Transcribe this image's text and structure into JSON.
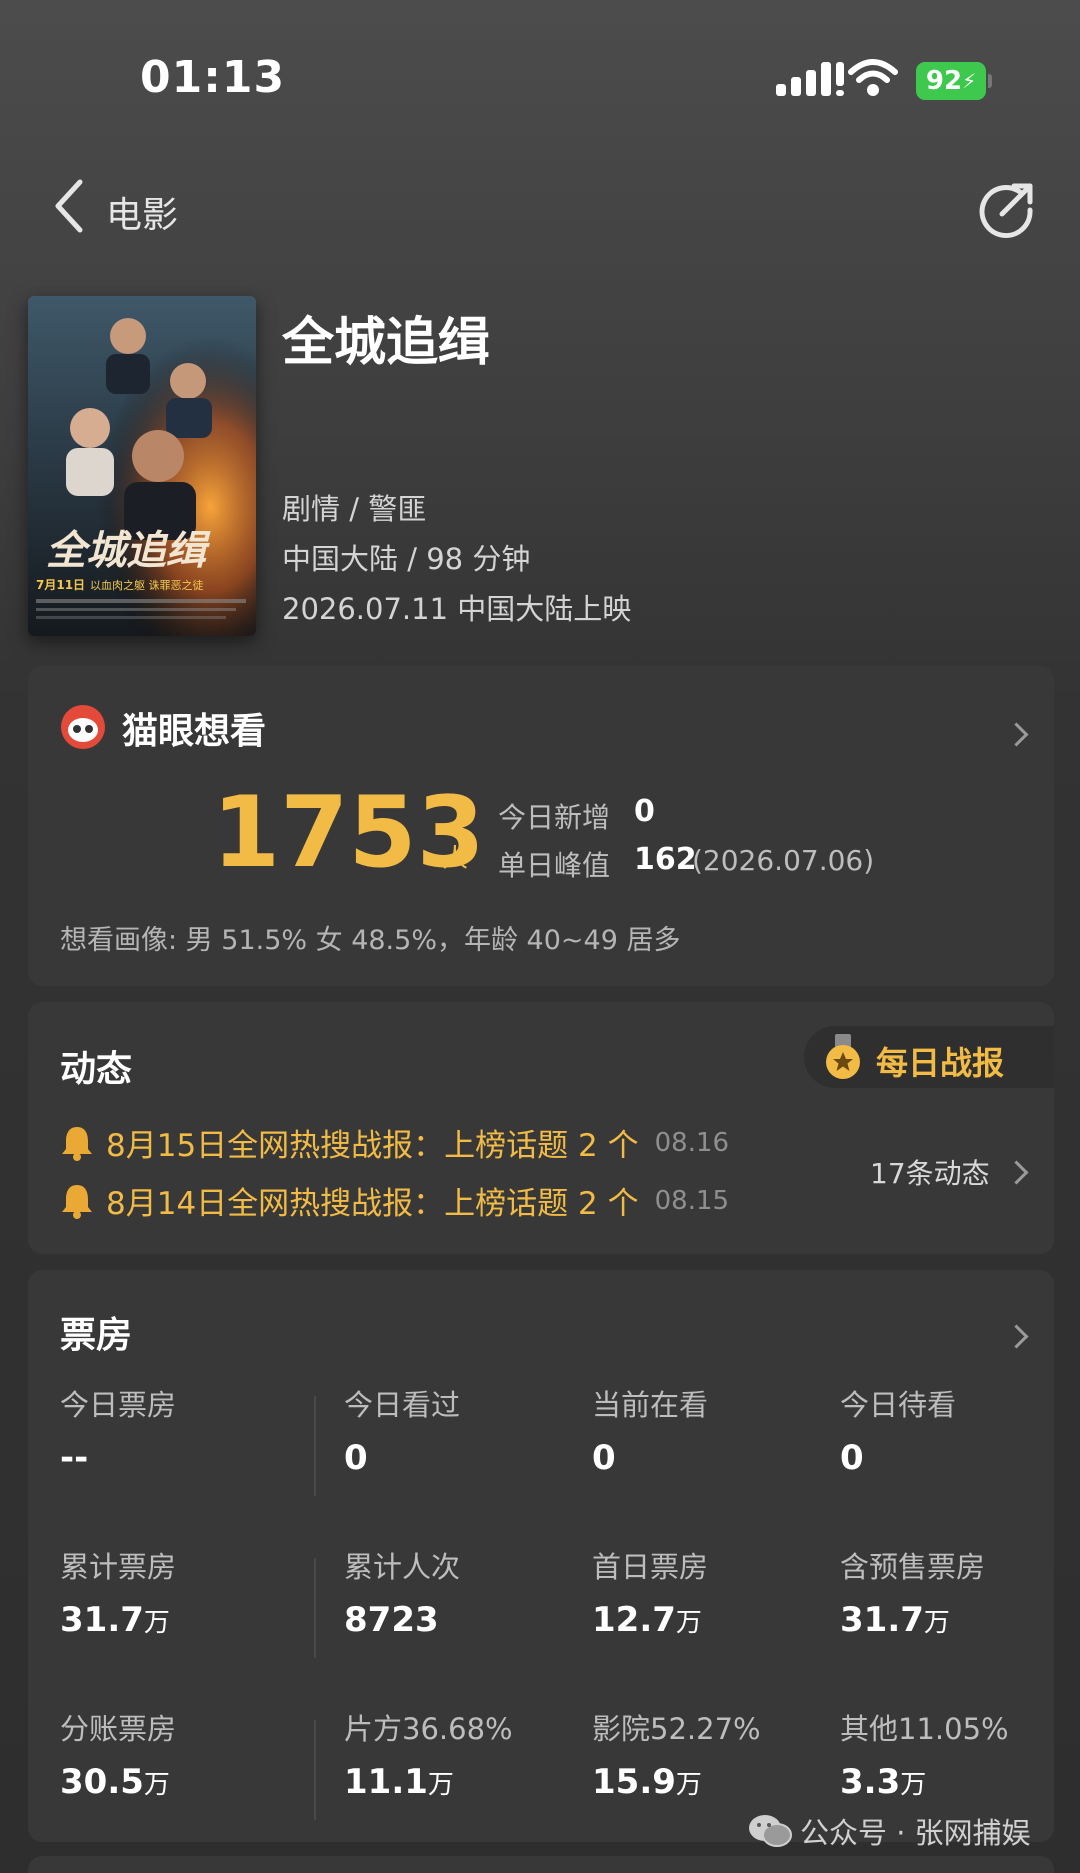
{
  "status_bar": {
    "time": "01:13",
    "battery": "92"
  },
  "nav": {
    "back_label": "电影"
  },
  "movie": {
    "title": "全城追缉",
    "genre": "剧情 / 警匪",
    "region_duration": "中国大陆 / 98 分钟",
    "release": "2026.07.11 中国大陆上映",
    "poster": {
      "title_text": "全城追缉",
      "date_text": "7月11日",
      "tagline": "以血肉之躯 诛罪恶之徒"
    }
  },
  "want": {
    "header": "猫眼想看",
    "count": "1753",
    "unit": "人",
    "today_label": "今日新增",
    "today_value": "0",
    "peak_label": "单日峰值",
    "peak_value": "162",
    "peak_date": "(2026.07.06)",
    "profile": "想看画像: 男 51.5%  女 48.5%，年龄 40~49 居多"
  },
  "news": {
    "header": "动态",
    "daily_badge": "每日战报",
    "items": [
      {
        "text": "8月15日全网热搜战报：上榜话题 2 个",
        "date": "08.16"
      },
      {
        "text": "8月14日全网热搜战报：上榜话题 2 个",
        "date": "08.15"
      }
    ],
    "more": "17条动态"
  },
  "box": {
    "header": "票房",
    "row1": [
      {
        "label": "今日票房",
        "value": "--",
        "unit": ""
      },
      {
        "label": "今日看过",
        "value": "0",
        "unit": ""
      },
      {
        "label": "当前在看",
        "value": "0",
        "unit": ""
      },
      {
        "label": "今日待看",
        "value": "0",
        "unit": ""
      }
    ],
    "row2": [
      {
        "label": "累计票房",
        "value": "31.7",
        "unit": "万"
      },
      {
        "label": "累计人次",
        "value": "8723",
        "unit": ""
      },
      {
        "label": "首日票房",
        "value": "12.7",
        "unit": "万"
      },
      {
        "label": "含预售票房",
        "value": "31.7",
        "unit": "万"
      }
    ],
    "row3": [
      {
        "label": "分账票房",
        "value": "30.5",
        "unit": "万"
      },
      {
        "label": "片方36.68%",
        "value": "11.1",
        "unit": "万"
      },
      {
        "label": "影院52.27%",
        "value": "15.9",
        "unit": "万"
      },
      {
        "label": "其他11.05%",
        "value": "3.3",
        "unit": "万"
      }
    ]
  },
  "watermark": "公众号 · 张网捕娱",
  "colors": {
    "accent_gold": "#f1bb45",
    "card_bg": "#383838",
    "battery_green": "#3ec94e"
  }
}
